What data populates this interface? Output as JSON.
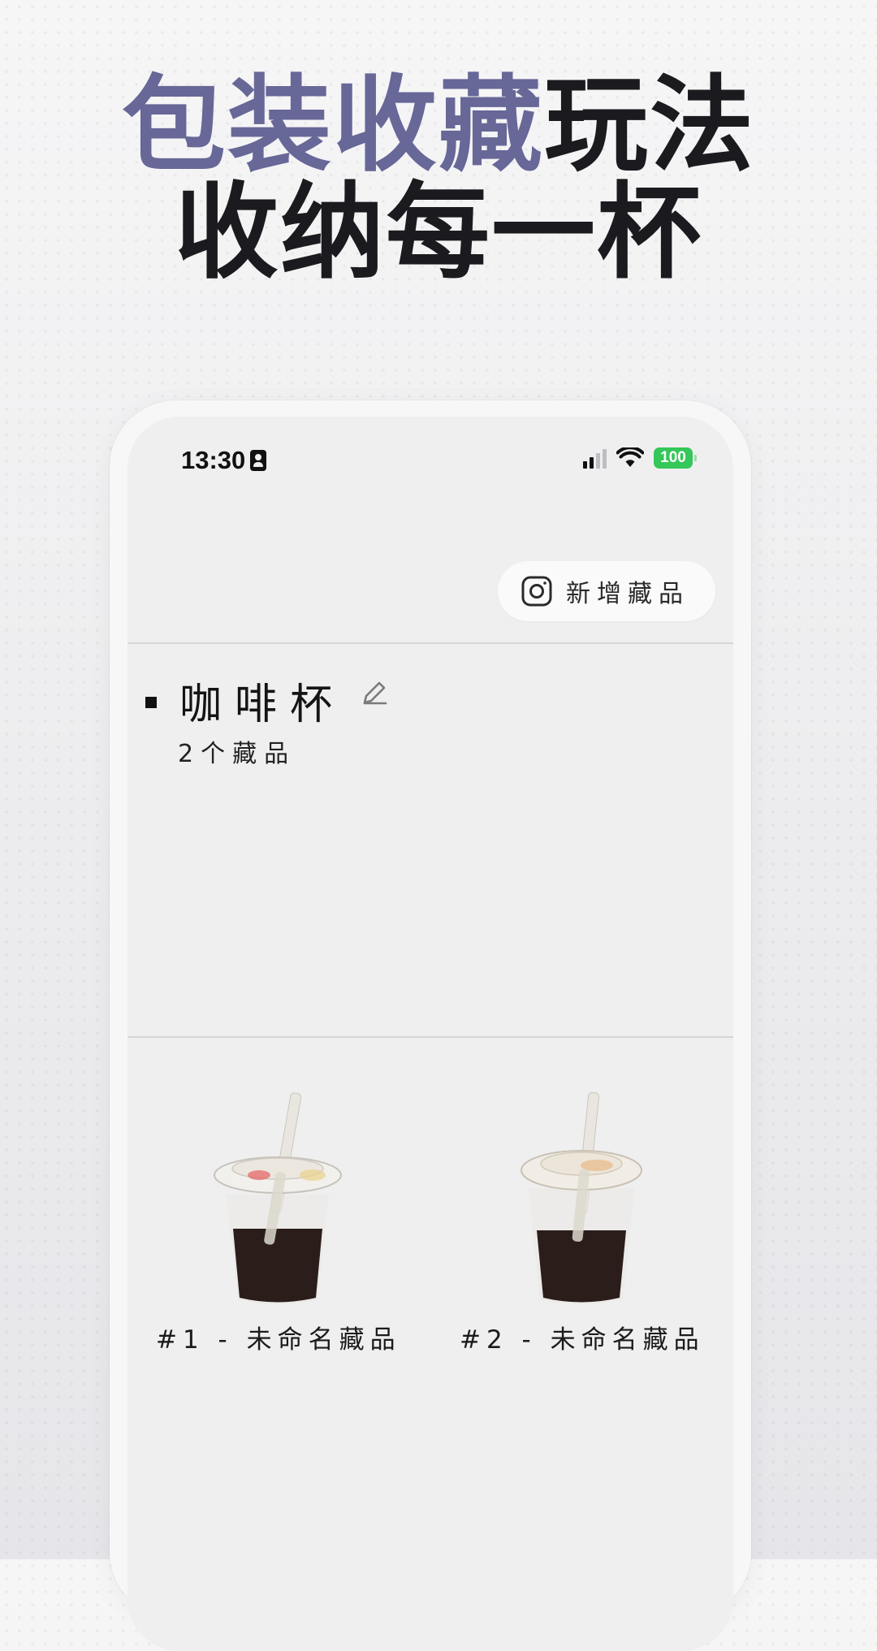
{
  "headline": {
    "line1_accent": "包装收藏",
    "line1_rest": "玩法",
    "line2": "收纳每一杯"
  },
  "status_bar": {
    "time": "13:30",
    "battery": "100",
    "icons": [
      "contact-icon",
      "signal-icon",
      "wifi-icon",
      "battery-icon"
    ]
  },
  "toolbar": {
    "add_label": "新增藏品",
    "add_icon": "camera-icon"
  },
  "collection": {
    "title": "咖啡杯",
    "edit_icon": "pencil-icon",
    "count_label": "2个藏品"
  },
  "items": [
    {
      "label": "#1 - 未命名藏品"
    },
    {
      "label": "#2 - 未命名藏品"
    }
  ],
  "colors": {
    "accent": "#676798",
    "battery": "#34c759",
    "background": "#ececee",
    "screen": "#efeff0"
  }
}
